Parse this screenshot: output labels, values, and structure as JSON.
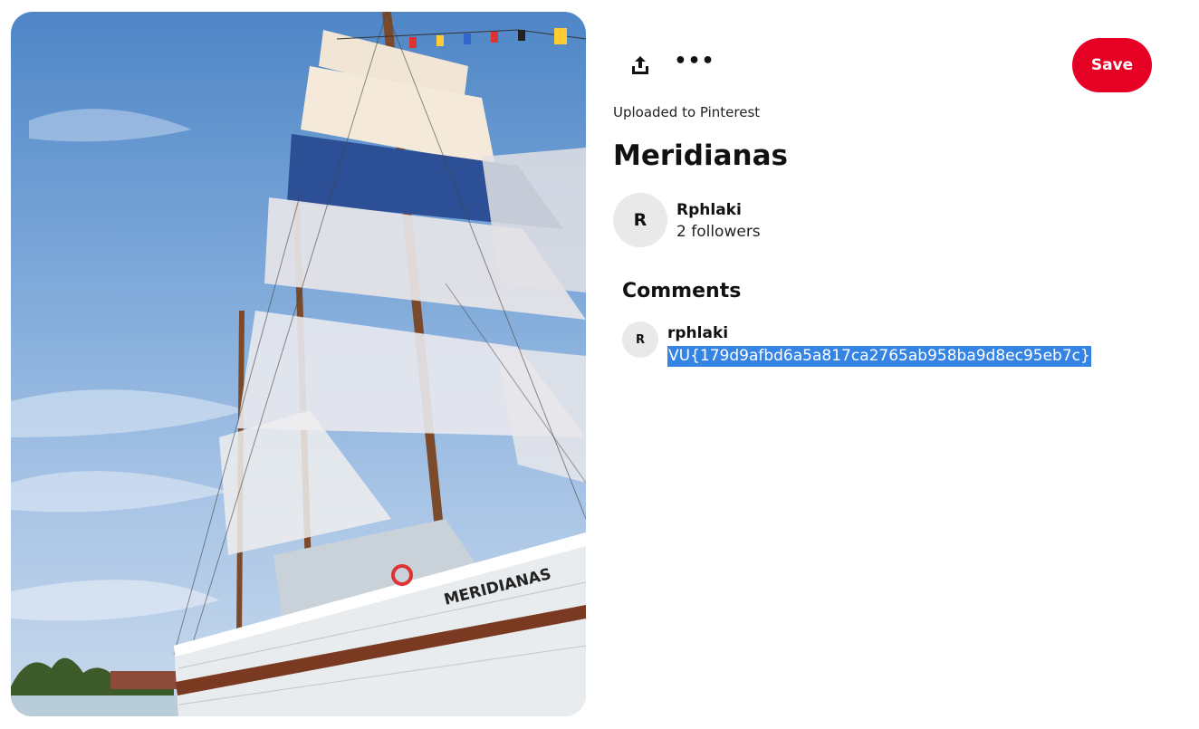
{
  "pin": {
    "image_alt": "MERIDIANAS",
    "hull_text": "MERIDIANAS",
    "uploaded_label": "Uploaded to Pinterest",
    "title": "Meridianas"
  },
  "actions": {
    "share_icon": "share-upload-icon",
    "more_icon": "more-dots-icon",
    "more_label": "•••",
    "save_label": "Save",
    "save_color": "#e60023"
  },
  "creator": {
    "avatar_initial": "R",
    "name": "Rphlaki",
    "followers": "2 followers"
  },
  "comments": {
    "heading": "Comments",
    "items": [
      {
        "avatar_initial": "R",
        "user": "rphlaki",
        "text": "VU{179d9afbd6a5a817ca2765ab958ba9d8ec95eb7c}",
        "highlight_color": "#3584e4"
      }
    ]
  }
}
